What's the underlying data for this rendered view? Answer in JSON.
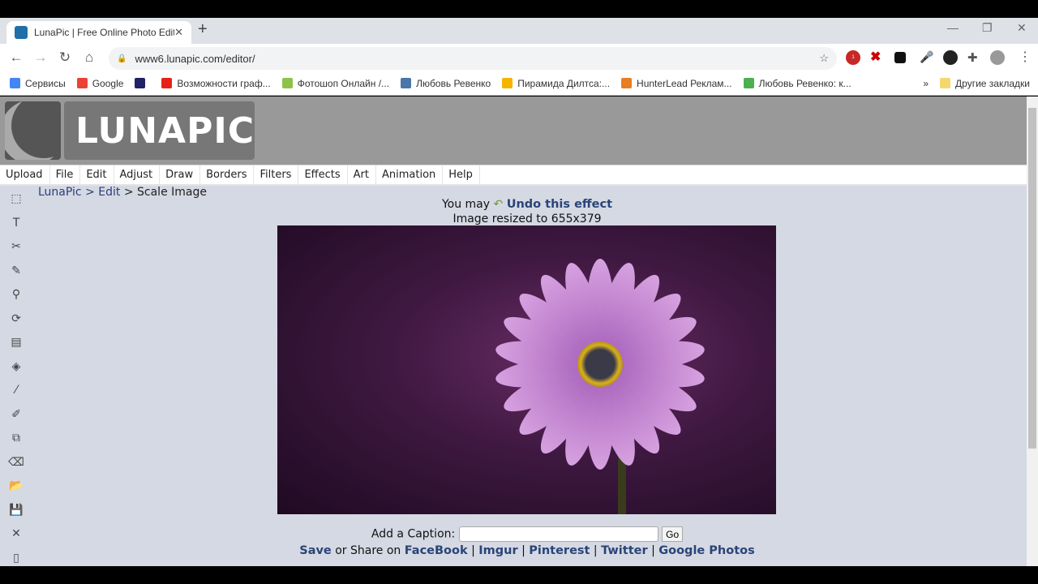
{
  "browser": {
    "tab_title": "LunaPic | Free Online Photo Editor",
    "url": "www6.lunapic.com/editor/",
    "bookmarks": [
      {
        "label": "Сервисы",
        "color": "#4285f4"
      },
      {
        "label": "Google",
        "color": "#ea4335"
      },
      {
        "label": "",
        "color": "#222266"
      },
      {
        "label": "Возможности граф...",
        "color": "#e62117"
      },
      {
        "label": "Фотошоп Онлайн /...",
        "color": "#8bc34a"
      },
      {
        "label": "Любовь Ревенко",
        "color": "#4a76a8"
      },
      {
        "label": "Пирамида Дилтса:...",
        "color": "#f4b400"
      },
      {
        "label": "HunterLead Реклам...",
        "color": "#e67e22"
      },
      {
        "label": "Любовь Ревенко: к...",
        "color": "#4caf50"
      }
    ],
    "other_bookmarks": "Другие закладки",
    "abp_badge": "1"
  },
  "site": {
    "logo": "LUNAPIC",
    "menu": [
      "Upload",
      "File",
      "Edit",
      "Adjust",
      "Draw",
      "Borders",
      "Filters",
      "Effects",
      "Art",
      "Animation",
      "Help"
    ],
    "breadcrumb": {
      "home": "LunaPic",
      "sep": ">",
      "section": "Edit",
      "page": "Scale Image"
    },
    "tools": [
      "select-icon",
      "text-icon",
      "scissors-icon",
      "pencil-icon",
      "magnifier-icon",
      "rotate-icon",
      "gradient-icon",
      "paint-bucket-icon",
      "eyedropper-icon",
      "brush-icon",
      "clone-icon",
      "eraser-icon",
      "open-folder-icon",
      "save-icon",
      "close-icon",
      "new-file-icon",
      "print-icon"
    ],
    "notice_prefix": "You may",
    "undo_label": "Undo this effect",
    "status": "Image resized to 655x379",
    "caption_label": "Add a Caption:",
    "caption_value": "",
    "go_label": "Go",
    "share": {
      "save": "Save",
      "middle": "or Share on",
      "links": [
        "FaceBook",
        "Imgur",
        "Pinterest",
        "Twitter",
        "Google Photos"
      ],
      "sep": "|"
    }
  }
}
